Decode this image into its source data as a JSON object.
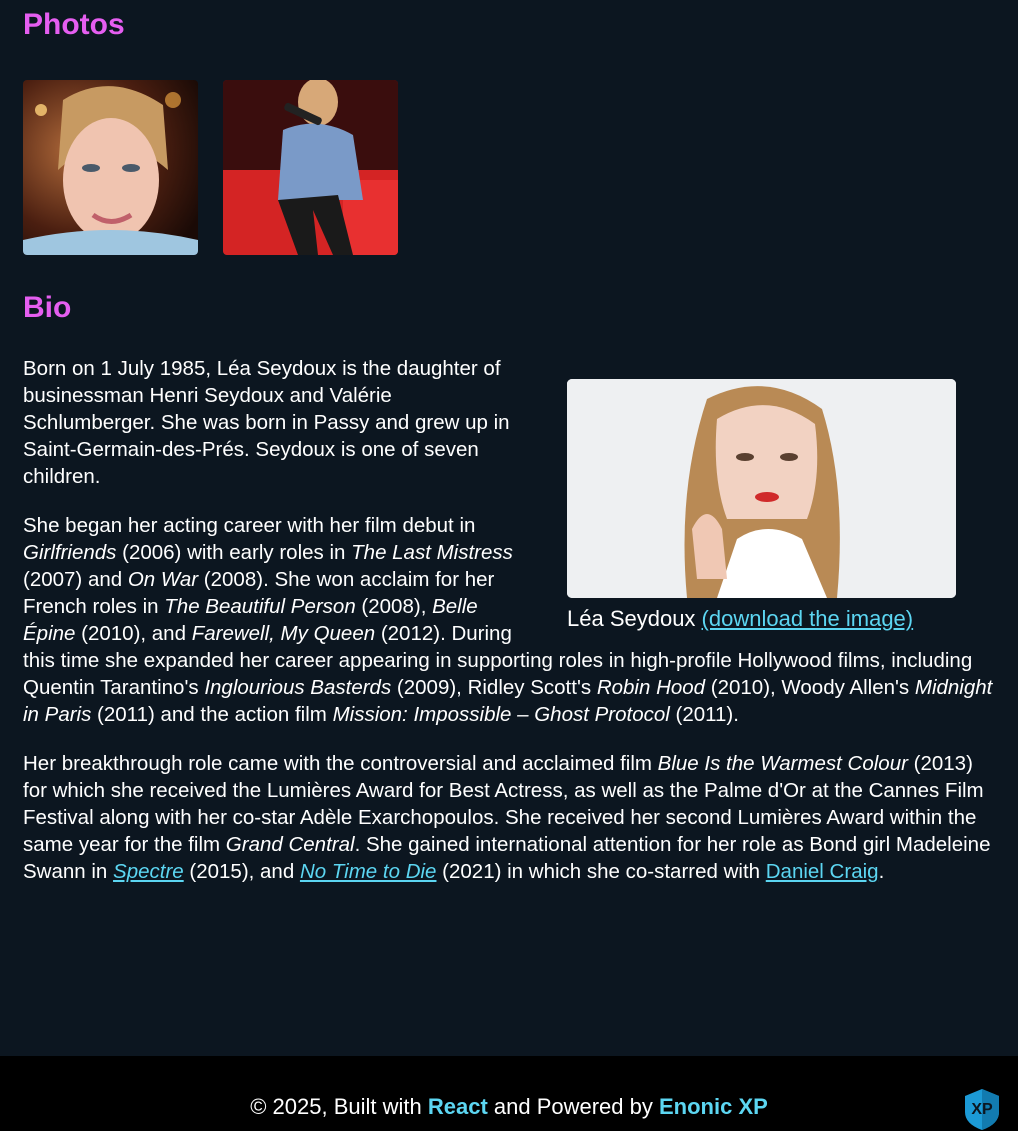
{
  "photos": {
    "heading": "Photos"
  },
  "bio": {
    "heading": "Bio",
    "p1": "Born on 1 July 1985, Léa Seydoux is the daughter of businessman Henri Seydoux and Valérie Schlumberger. She was born in Passy and grew up in Saint-Germain-des-Prés. Seydoux is one of seven children.",
    "p2": {
      "t1": "She began her acting career with her film debut in ",
      "f1": "Girlfriends",
      "t2": " (2006) with early roles in ",
      "f2": "The Last Mistress",
      "t3": " (2007) and ",
      "f3": "On War",
      "t4": " (2008). She won acclaim for her French roles in ",
      "f4": "The Beautiful Person",
      "t5": " (2008), ",
      "f5": "Belle Épine",
      "t6": " (2010), and ",
      "f6": "Farewell, My Queen",
      "t7": " (2012). During this time she expanded her career appearing in supporting roles in high-profile Hollywood films, including Quentin Tarantino's ",
      "f7": "Inglourious Basterds",
      "t8": " (2009), Ridley Scott's ",
      "f8": "Robin Hood",
      "t9": " (2010), Woody Allen's ",
      "f9": "Midnight in Paris",
      "t10": " (2011) and the action film ",
      "f10": "Mission: Impossible – Ghost Protocol",
      "t11": " (2011)."
    },
    "p3": {
      "t1": "Her breakthrough role came with the controversial and acclaimed film ",
      "f1": "Blue Is the Warmest Colour",
      "t2": " (2013) for which she received the Lumières Award for Best Actress, as well as the Palme d'Or at the Cannes Film Festival along with her co-star Adèle Exarchopoulos. She received her second Lumières Award within the same year for the film ",
      "f2": "Grand Central",
      "t3": ". She gained international attention for her role as Bond girl Madeleine Swann in ",
      "link1": "Spectre",
      "t4": " (2015), and ",
      "link2": "No Time to Die",
      "t5": " (2021) in which she co-starred with ",
      "link3": "Daniel Craig",
      "t6": "."
    },
    "figure": {
      "caption": "Léa Seydoux ",
      "download_link": "(download the image)"
    }
  },
  "footer": {
    "prefix": "© 2025, Built with ",
    "react": "React",
    "middle": " and Powered by ",
    "enonic": "Enonic XP",
    "logo_text": "XP"
  },
  "colors": {
    "heading": "#e55ef0",
    "link": "#5cd6f2",
    "background": "#0c1620",
    "footer": "#000000"
  }
}
